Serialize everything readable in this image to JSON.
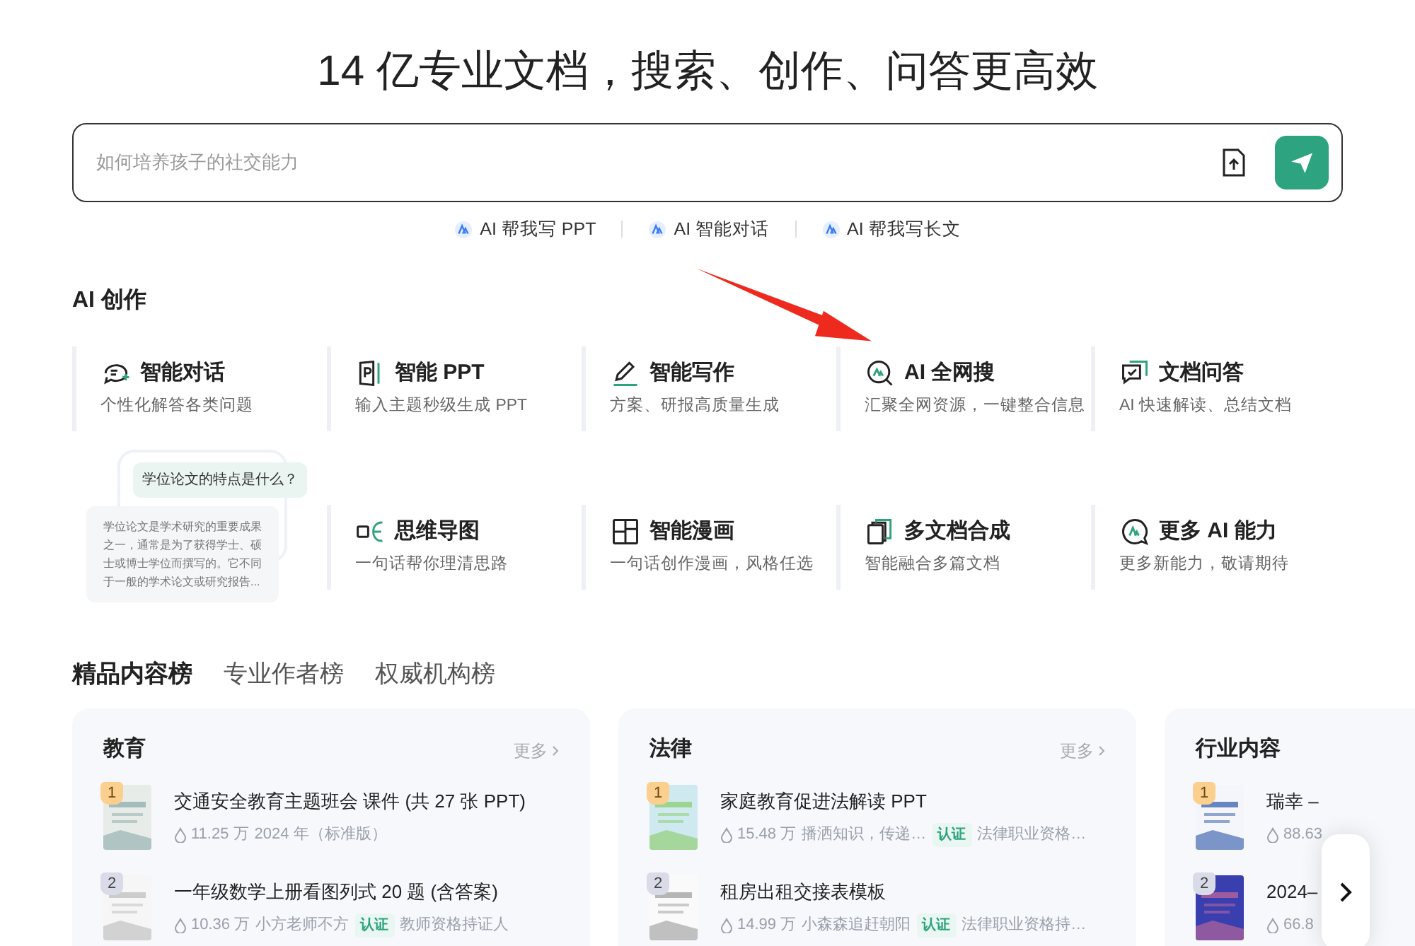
{
  "headline": "14 亿专业文档，搜索、创作、问答更高效",
  "search": {
    "placeholder": "如何培养孩子的社交能力"
  },
  "quick_links": [
    "AI 帮我写 PPT",
    "AI 智能对话",
    "AI 帮我写长文"
  ],
  "section_title": "AI 创作",
  "tools": [
    {
      "kind": "chat",
      "title": "智能对话",
      "subtitle": "个性化解答各类问题"
    },
    {
      "kind": "ppt",
      "title": "智能 PPT",
      "subtitle": "输入主题秒级生成 PPT"
    },
    {
      "kind": "write",
      "title": "智能写作",
      "subtitle": "方案、研报高质量生成"
    },
    {
      "kind": "search",
      "title": "AI 全网搜",
      "subtitle": "汇聚全网资源，一键整合信息"
    },
    {
      "kind": "docqa",
      "title": "文档问答",
      "subtitle": "AI 快速解读、总结文档"
    },
    {
      "kind": "preview",
      "question": "学位论文的特点是什么？",
      "answer": "学位论文是学术研究的重要成果之一，通常是为了获得学士、硕士或博士学位而撰写的。它不同于一般的学术论文或研究报告..."
    },
    {
      "kind": "mindmap",
      "title": "思维导图",
      "subtitle": "一句话帮你理清思路"
    },
    {
      "kind": "comic",
      "title": "智能漫画",
      "subtitle": "一句话创作漫画，风格任选"
    },
    {
      "kind": "merge",
      "title": "多文档合成",
      "subtitle": "智能融合多篇文档"
    },
    {
      "kind": "more",
      "title": "更多 AI 能力",
      "subtitle": "更多新能力，敬请期待"
    }
  ],
  "rank_tabs": [
    {
      "label": "精品内容榜",
      "selected": true
    },
    {
      "label": "专业作者榜",
      "selected": false
    },
    {
      "label": "权威机构榜",
      "selected": false
    }
  ],
  "cards": [
    {
      "title": "教育",
      "more": "更多",
      "items": [
        {
          "rank": "1",
          "title": "交通安全教育主题班会 课件 (共 27 张 PPT)",
          "views": "11.25 万",
          "author": "2024 年（标准版）",
          "verified": false
        },
        {
          "rank": "2",
          "title": "一年级数学上册看图列式 20 题 (含答案)",
          "views": "10.36 万",
          "author": "小方老师不方",
          "verified": true,
          "badge": "认证",
          "credential": "教师资格持证人"
        }
      ]
    },
    {
      "title": "法律",
      "more": "更多",
      "items": [
        {
          "rank": "1",
          "title": "家庭教育促进法解读 PPT",
          "views": "15.48 万",
          "author": "播洒知识，传递…",
          "verified": true,
          "badge": "认证",
          "credential": "法律职业资格…"
        },
        {
          "rank": "2",
          "title": "租房出租交接表模板",
          "views": "14.99 万",
          "author": "小森森追赶朝阳",
          "verified": true,
          "badge": "认证",
          "credential": "法律职业资格持…"
        }
      ]
    },
    {
      "title": "行业内容",
      "items": [
        {
          "rank": "1",
          "title": "瑞幸 –",
          "views": "88.63",
          "verified": false
        },
        {
          "rank": "2",
          "title": "2024–",
          "views": "66.8",
          "verified": false
        }
      ]
    }
  ]
}
